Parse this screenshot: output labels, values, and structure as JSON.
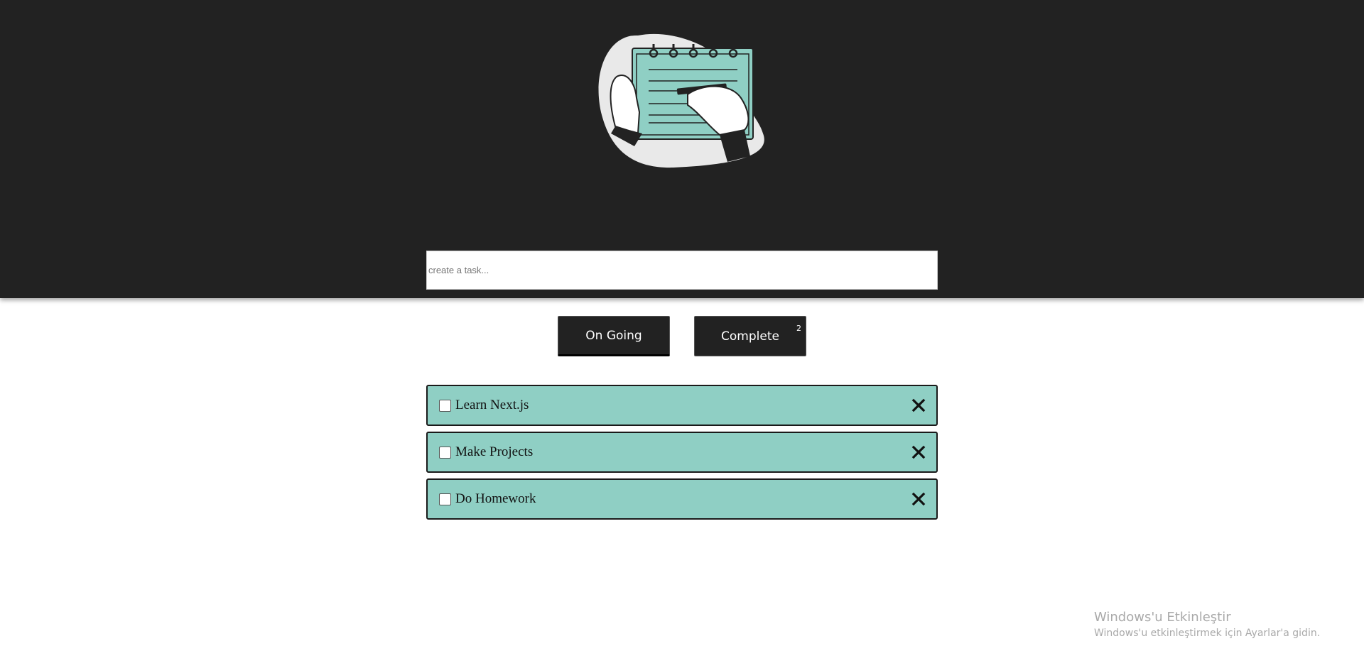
{
  "header": {
    "illustration": "hand-writing-notepad-illustration",
    "colors": {
      "background": "#222222",
      "accent": "#8fcfc4"
    }
  },
  "task_input": {
    "value": "",
    "placeholder": "create a task..."
  },
  "tabs": [
    {
      "label": "On Going",
      "active": true
    },
    {
      "label": "Complete",
      "count": "2"
    }
  ],
  "todos": [
    {
      "text": "Learn Next.js",
      "checked": false
    },
    {
      "text": "Make Projects",
      "checked": false
    },
    {
      "text": "Do Homework",
      "checked": false
    }
  ],
  "icons": {
    "delete": "close-icon",
    "checkbox": "checkbox-icon"
  },
  "watermark": {
    "title": "Windows'u Etkinleştir",
    "subtitle": "Windows'u etkinleştirmek için Ayarlar'a gidin."
  }
}
